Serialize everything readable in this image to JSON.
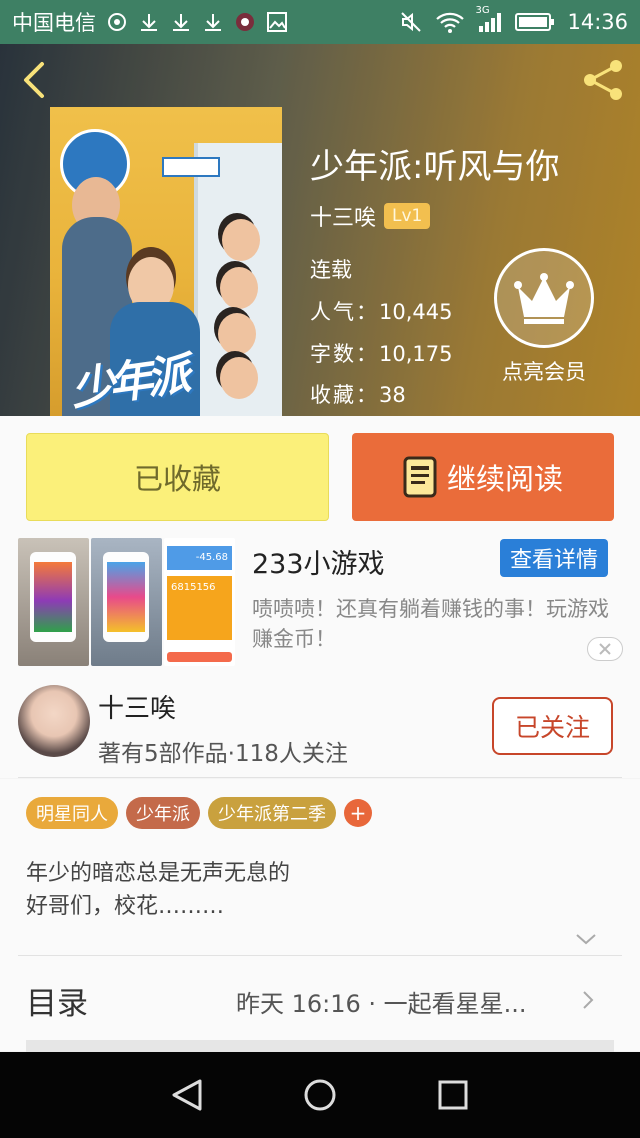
{
  "status_bar": {
    "carrier": "中国电信",
    "network": "3G",
    "time": "14:36"
  },
  "header": {
    "book_title": "少年派:听风与你",
    "author": "十三唉",
    "level": "Lv1",
    "status": "连载",
    "popularity_label": "人气：",
    "popularity_value": "10,445",
    "words_label": "字数：",
    "words_value": "10,175",
    "favorites_label": "收藏：",
    "favorites_value": "38",
    "vip_label": "点亮会员",
    "cover_logo": "少年派"
  },
  "actions": {
    "collect_label": "已收藏",
    "read_label": "继续阅读"
  },
  "ad": {
    "title": "233小游戏",
    "button": "查看详情",
    "description": "啧啧啧！还真有躺着赚钱的事！玩游戏赚金币！",
    "img3_top": "-45.68",
    "img3_mid": "6815156"
  },
  "author_section": {
    "name": "十三唉",
    "meta": "著有5部作品·118人关注",
    "follow_label": "已关注"
  },
  "tags": [
    {
      "label": "明星同人",
      "color": "#e9a93b"
    },
    {
      "label": "少年派",
      "color": "#c46a4a"
    },
    {
      "label": "少年派第二季",
      "color": "#c9a13e"
    }
  ],
  "tag_add": "+",
  "synopsis": {
    "line1": "年少的暗恋总是无声无息的",
    "line2": "好哥们，校花………"
  },
  "toc": {
    "label": "目录",
    "latest": "昨天 16:16 · 一起看星星..."
  },
  "icons": [
    "back-icon",
    "share-icon",
    "crown-icon",
    "book-icon",
    "close-icon",
    "chevron-down-icon",
    "chevron-right-icon",
    "nav-back-icon",
    "nav-home-icon",
    "nav-recents-icon"
  ]
}
